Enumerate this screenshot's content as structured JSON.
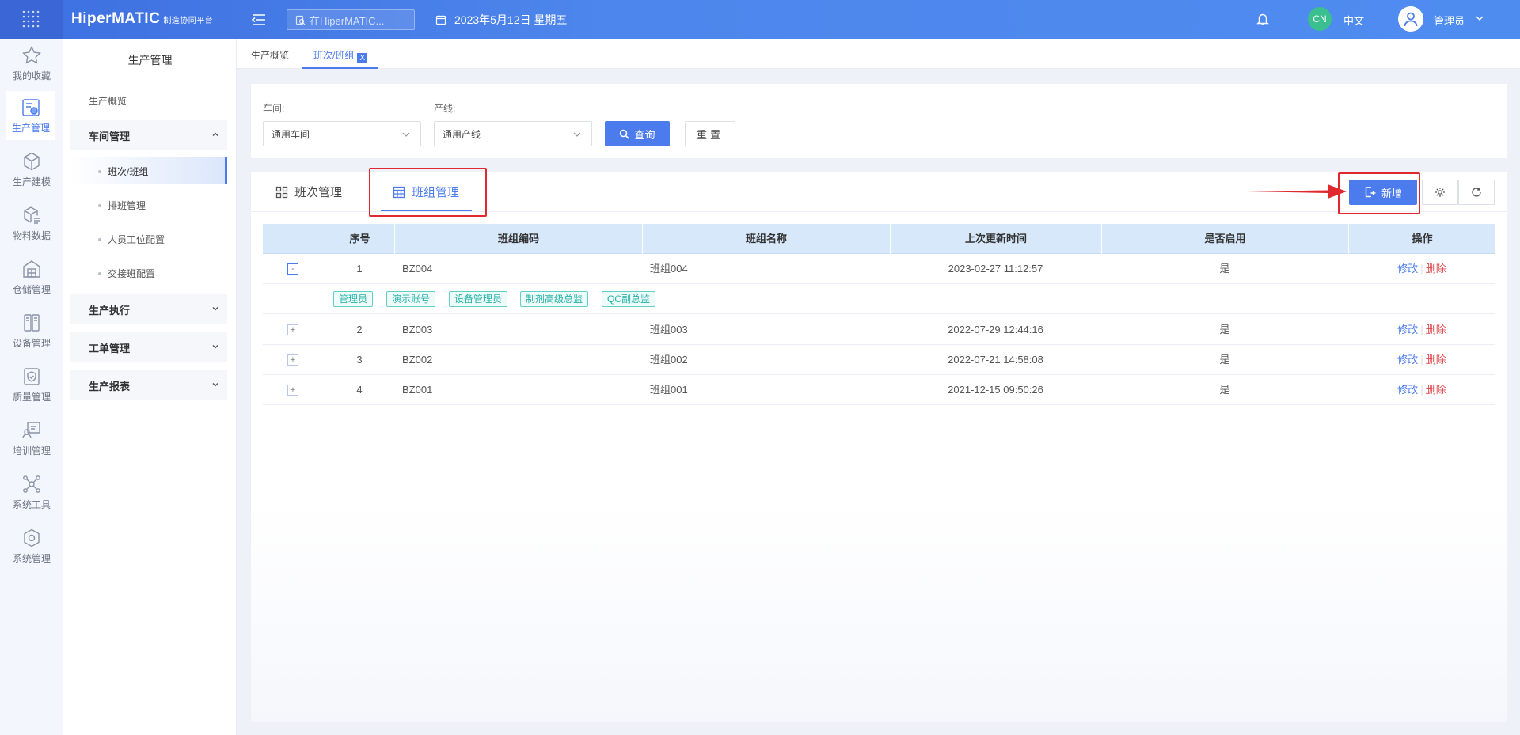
{
  "header": {
    "brand": "HiperMATIC",
    "brand_sub": "制造协同平台",
    "search_placeholder": "在HiperMATIC...",
    "date": "2023年5月12日 星期五",
    "lang_badge": "CN",
    "lang": "中文",
    "user": "管理员"
  },
  "rail": {
    "items": [
      {
        "label": "我的收藏",
        "icon": "star-icon"
      },
      {
        "label": "生产管理",
        "icon": "production-icon"
      },
      {
        "label": "生产建模",
        "icon": "cube-icon"
      },
      {
        "label": "物料数据",
        "icon": "material-icon"
      },
      {
        "label": "仓储管理",
        "icon": "warehouse-icon"
      },
      {
        "label": "设备管理",
        "icon": "device-icon"
      },
      {
        "label": "质量管理",
        "icon": "shield-icon"
      },
      {
        "label": "培训管理",
        "icon": "training-icon"
      },
      {
        "label": "系统工具",
        "icon": "network-icon"
      },
      {
        "label": "系统管理",
        "icon": "settings-cube-icon"
      }
    ]
  },
  "sidebar": {
    "title": "生产管理",
    "overview": "生产概览",
    "groups": [
      {
        "label": "车间管理",
        "children": [
          "班次/班组",
          "排班管理",
          "人员工位配置",
          "交接班配置"
        ]
      },
      {
        "label": "生产执行"
      },
      {
        "label": "工单管理"
      },
      {
        "label": "生产报表"
      }
    ]
  },
  "page_tabs": {
    "items": [
      "生产概览",
      "班次/班组"
    ],
    "close": "X"
  },
  "filter": {
    "workshop_label": "车间:",
    "workshop_value": "通用车间",
    "line_label": "产线:",
    "line_value": "通用产线",
    "query": "查询",
    "reset": "重置"
  },
  "panel": {
    "tabs": [
      "班次管理",
      "班组管理"
    ],
    "add": "新增"
  },
  "table": {
    "columns": [
      "序号",
      "班组编码",
      "班组名称",
      "上次更新时间",
      "是否启用",
      "操作"
    ],
    "rows": [
      {
        "expander": "-",
        "no": "1",
        "code": "BZ004",
        "name": "班组004",
        "updated": "2023-02-27 11:12:57",
        "enabled": "是",
        "edit": "修改",
        "del": "删除"
      },
      {
        "expander": "+",
        "no": "2",
        "code": "BZ003",
        "name": "班组003",
        "updated": "2022-07-29 12:44:16",
        "enabled": "是",
        "edit": "修改",
        "del": "删除"
      },
      {
        "expander": "+",
        "no": "3",
        "code": "BZ002",
        "name": "班组002",
        "updated": "2022-07-21 14:58:08",
        "enabled": "是",
        "edit": "修改",
        "del": "删除"
      },
      {
        "expander": "+",
        "no": "4",
        "code": "BZ001",
        "name": "班组001",
        "updated": "2021-12-15 09:50:26",
        "enabled": "是",
        "edit": "修改",
        "del": "删除"
      }
    ],
    "expanded_tags": [
      "管理员",
      "演示账号",
      "设备管理员",
      "制剂高级总监",
      "QC副总监"
    ]
  },
  "colors": {
    "accent": "#4b7bec",
    "danger": "#e0474c",
    "highlight": "#e0282e",
    "tag": "#21b3a6"
  }
}
